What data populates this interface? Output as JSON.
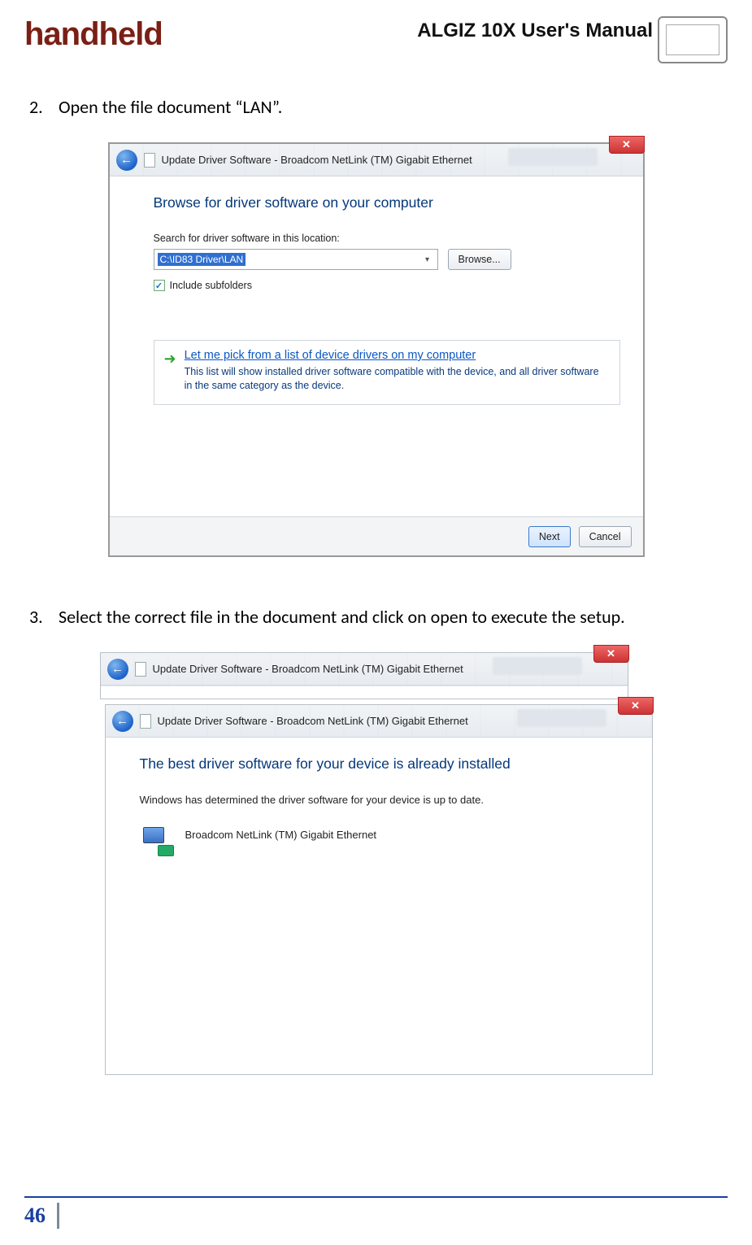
{
  "header": {
    "logo": "handheld",
    "title": "ALGIZ 10X User's Manual"
  },
  "steps": {
    "two": {
      "num": "2.",
      "text": "Open the file document “LAN”."
    },
    "three": {
      "num": "3.",
      "text": "Select the correct file in the document and click on open to execute the setup."
    }
  },
  "shot1": {
    "close": "✕",
    "back_arrow": "←",
    "title": "Update Driver Software - Broadcom NetLink (TM) Gigabit Ethernet",
    "heading": "Browse for driver software on your computer",
    "search_label": "Search for driver software in this location:",
    "path_value": "C:\\ID83 Driver\\LAN",
    "dropdown_caret": "▾",
    "browse": "Browse...",
    "include_check": "✓",
    "include_label": "Include subfolders",
    "pick_arrow": "➜",
    "pick_link": "Let me pick from a list of device drivers on my computer",
    "pick_desc": "This list will show installed driver software compatible with the device, and all driver software in the same category as the device.",
    "next": "Next",
    "cancel": "Cancel"
  },
  "shot2": {
    "close": "✕",
    "back_arrow": "←",
    "back_title": "Update Driver Software - Broadcom NetLink (TM) Gigabit Ethernet",
    "front_title": "Update Driver Software - Broadcom NetLink (TM) Gigabit Ethernet",
    "heading": "The best driver software for your device is already installed",
    "subtext": "Windows has determined the driver software for your device is up to date.",
    "device_name": "Broadcom NetLink (TM) Gigabit Ethernet"
  },
  "footer": {
    "page_number": "46"
  }
}
